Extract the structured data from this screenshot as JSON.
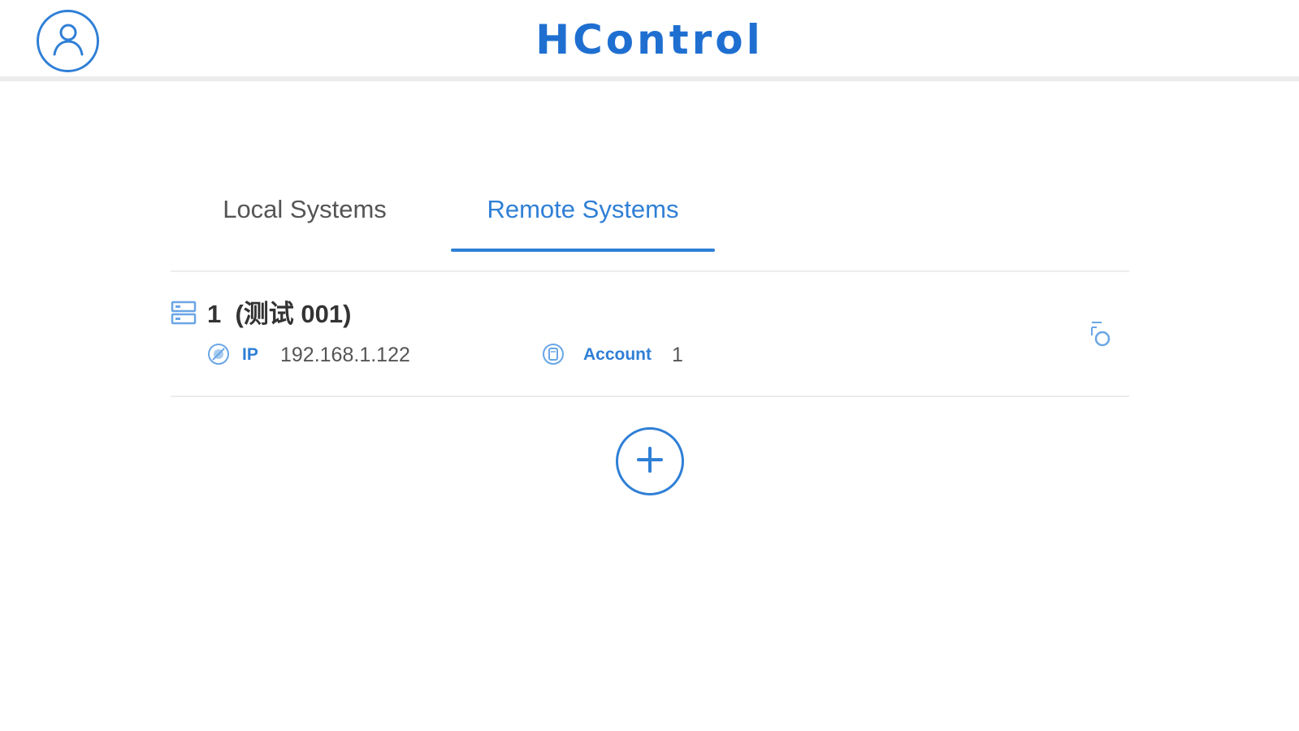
{
  "app": {
    "title": "HControl",
    "accent_color": "#2f7fd6",
    "title_color": "#1f6fd1"
  },
  "header": {
    "profile_icon": "user-profile-icon"
  },
  "tabs": [
    {
      "label": "Local Systems",
      "active": false
    },
    {
      "label": "Remote Systems",
      "active": true
    }
  ],
  "systems": [
    {
      "name": "1  (测试 001)",
      "icon": "server-icon",
      "ip_label": "IP",
      "ip_icon": "globe-icon",
      "ip": "192.168.1.122",
      "account_label": "Account",
      "account_icon": "account-icon",
      "account": "1",
      "action_icon": "refresh-icon"
    }
  ],
  "add_button_icon": "plus-icon"
}
